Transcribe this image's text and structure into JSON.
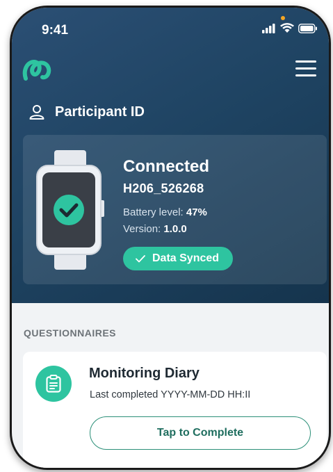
{
  "status_bar": {
    "time": "9:41"
  },
  "header": {
    "logo_icon": "loop-logo-icon",
    "menu_icon": "hamburger-menu-icon"
  },
  "participant": {
    "label": "Participant ID",
    "icon": "user-icon"
  },
  "device": {
    "status": "Connected",
    "id": "H206_526268",
    "battery_label": "Battery level: ",
    "battery_value": "47%",
    "version_label": "Version: ",
    "version_value": "1.0.0",
    "sync_label": "Data Synced"
  },
  "questionnaires": {
    "section_title": "QUESTIONNAIRES",
    "items": [
      {
        "title": "Monitoring Diary",
        "subtitle": "Last completed YYYY-MM-DD HH:II",
        "button_label": "Tap to Complete",
        "icon": "clipboard-icon"
      }
    ]
  },
  "colors": {
    "accent": "#2ec4a0",
    "header_bg": "#1f4463",
    "button_text": "#1f6e5f"
  }
}
